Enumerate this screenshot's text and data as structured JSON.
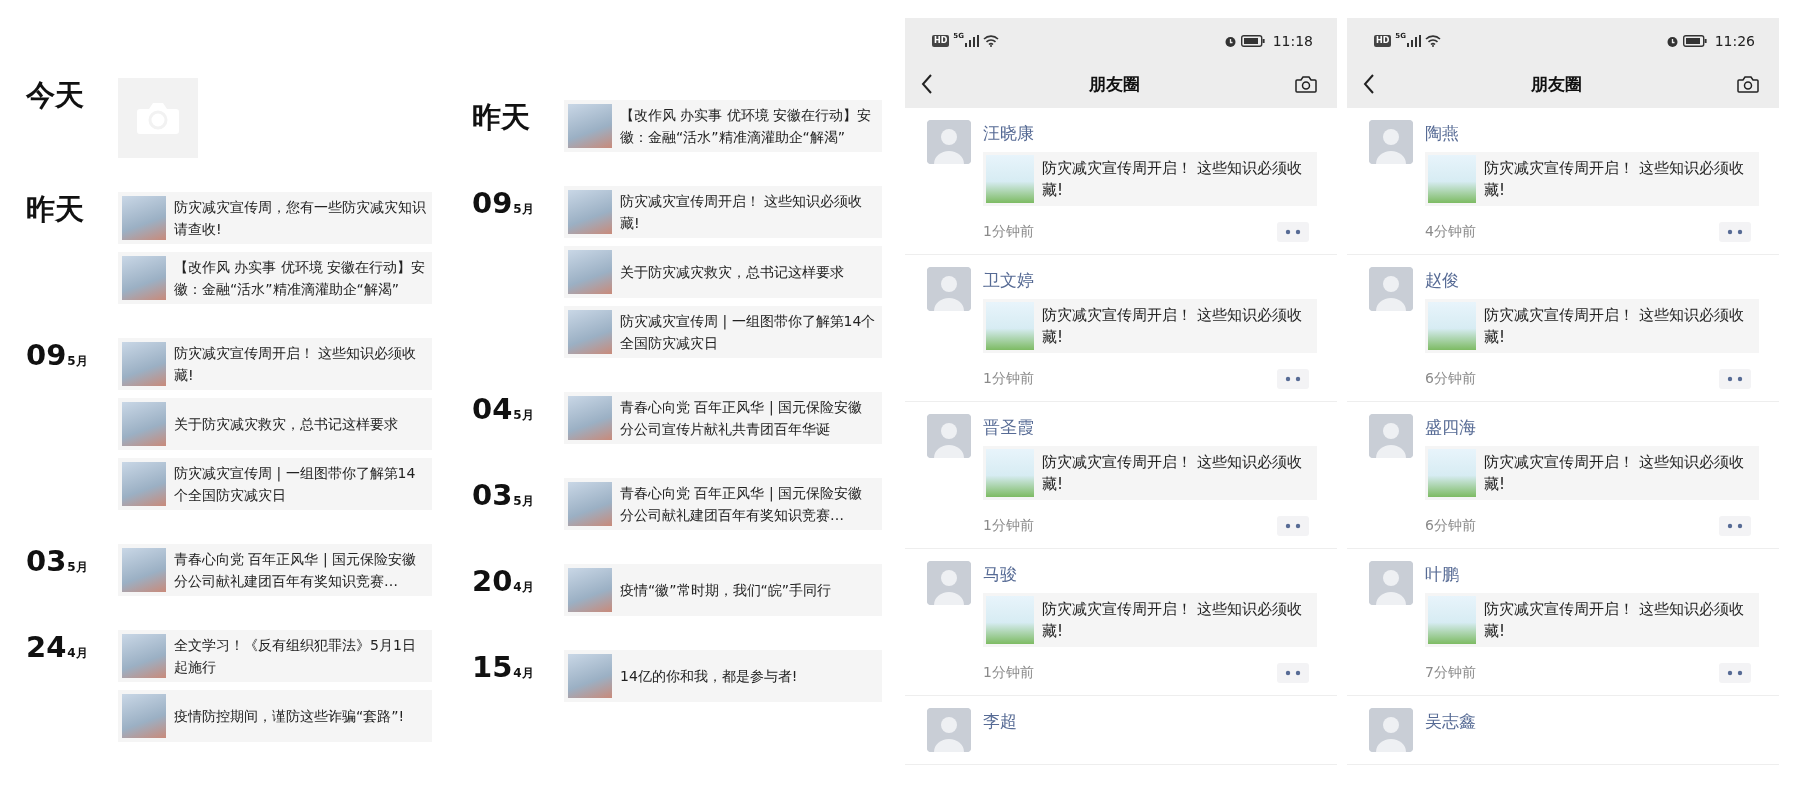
{
  "albums": [
    {
      "groups": [
        {
          "kind": "upload",
          "day": "今天"
        },
        {
          "kind": "posts",
          "day": "昨天",
          "entries": [
            {
              "title": "防灾减灾宣传周，您有一些防灾减灾知识请查收!"
            },
            {
              "title": "【改作风 办实事 优环境 安徽在行动】安徽：金融“活水”精准滴灌助企“解渴”"
            }
          ]
        },
        {
          "kind": "posts",
          "day": "09",
          "month": "5月",
          "entries": [
            {
              "title": "防灾减灾宣传周开启！ 这些知识必须收藏!"
            },
            {
              "title": "关于防灾减灾救灾，总书记这样要求"
            },
            {
              "title": "防灾减灾宣传周 | 一组图带你了解第14个全国防灾减灾日"
            }
          ]
        },
        {
          "kind": "posts",
          "day": "03",
          "month": "5月",
          "entries": [
            {
              "title": "青春心向党 百年正风华 | 国元保险安徽分公司献礼建团百年有奖知识竞赛…"
            }
          ]
        },
        {
          "kind": "posts",
          "day": "24",
          "month": "4月",
          "entries": [
            {
              "title": "全文学习！《反有组织犯罪法》5月1日起施行"
            },
            {
              "title": "疫情防控期间，谨防这些诈骗“套路”!"
            }
          ]
        }
      ]
    },
    {
      "groups": [
        {
          "kind": "posts",
          "day": "昨天",
          "entries": [
            {
              "title": "【改作风 办实事 优环境 安徽在行动】安徽：金融“活水”精准滴灌助企“解渴”"
            }
          ]
        },
        {
          "kind": "posts",
          "day": "09",
          "month": "5月",
          "entries": [
            {
              "title": "防灾减灾宣传周开启！ 这些知识必须收藏!"
            },
            {
              "title": "关于防灾减灾救灾，总书记这样要求"
            },
            {
              "title": "防灾减灾宣传周 | 一组图带你了解第14个全国防灾减灾日"
            }
          ]
        },
        {
          "kind": "posts",
          "day": "04",
          "month": "5月",
          "entries": [
            {
              "title": "青春心向党 百年正风华 | 国元保险安徽分公司宣传片献礼共青团百年华诞"
            }
          ]
        },
        {
          "kind": "posts",
          "day": "03",
          "month": "5月",
          "entries": [
            {
              "title": "青春心向党 百年正风华 | 国元保险安徽分公司献礼建团百年有奖知识竞赛…"
            }
          ]
        },
        {
          "kind": "posts",
          "day": "20",
          "month": "4月",
          "entries": [
            {
              "title": "疫情“徽”常时期，我们“皖”手同行"
            }
          ]
        },
        {
          "kind": "posts",
          "day": "15",
          "month": "4月",
          "entries": [
            {
              "title": "14亿的你和我，都是参与者!"
            }
          ]
        }
      ]
    }
  ],
  "feeds": [
    {
      "status_bar": {
        "network_badge": "HD",
        "network": "5G",
        "time": "11:18"
      },
      "title": "朋友圈",
      "posts": [
        {
          "name": "汪晓康",
          "link_title": "防灾减灾宣传周开启！ 这些知识必须收藏!",
          "time": "1分钟前"
        },
        {
          "name": "卫文婷",
          "link_title": "防灾减灾宣传周开启！ 这些知识必须收藏!",
          "time": "1分钟前"
        },
        {
          "name": "晋圣霞",
          "link_title": "防灾减灾宣传周开启！ 这些知识必须收藏!",
          "time": "1分钟前"
        },
        {
          "name": "马骏",
          "link_title": "防灾减灾宣传周开启！ 这些知识必须收藏!",
          "time": "1分钟前"
        },
        {
          "name": "李超"
        }
      ]
    },
    {
      "status_bar": {
        "network_badge": "HD",
        "network": "5G",
        "time": "11:26"
      },
      "title": "朋友圈",
      "posts": [
        {
          "name": "陶燕",
          "link_title": "防灾减灾宣传周开启！ 这些知识必须收藏!",
          "time": "4分钟前"
        },
        {
          "name": "赵俊",
          "link_title": "防灾减灾宣传周开启！ 这些知识必须收藏!",
          "time": "6分钟前"
        },
        {
          "name": "盛四海",
          "link_title": "防灾减灾宣传周开启！ 这些知识必须收藏!",
          "time": "6分钟前"
        },
        {
          "name": "叶鹏",
          "link_title": "防灾减灾宣传周开启！ 这些知识必须收藏!",
          "time": "7分钟前"
        },
        {
          "name": "吴志鑫"
        }
      ]
    }
  ]
}
